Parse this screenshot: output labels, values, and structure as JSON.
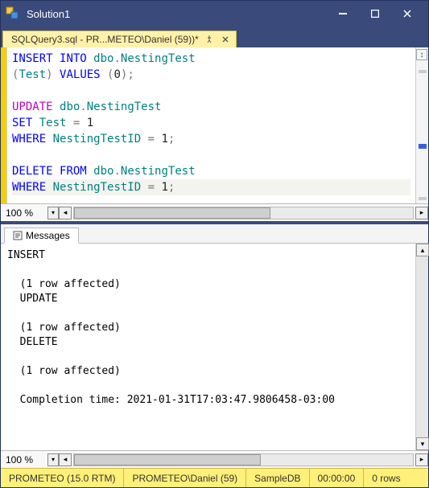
{
  "window": {
    "title": "Solution1"
  },
  "tab": {
    "label": "SQLQuery3.sql - PR...METEO\\Daniel (59))*"
  },
  "editor": {
    "zoom": "100 %",
    "code": {
      "l1_kw1": "INSERT",
      "l1_kw2": "INTO",
      "l1_obj": "dbo",
      "l1_dot": ".",
      "l1_tbl": "NestingTest",
      "l2_open": "(",
      "l2_col": "Test",
      "l2_close": ")",
      "l2_kw": "VALUES",
      "l2_open2": "(",
      "l2_val": "0",
      "l2_close2": ")",
      "l2_semi": ";",
      "l3": "",
      "l4_kw": "UPDATE",
      "l4_obj": "dbo",
      "l4_dot": ".",
      "l4_tbl": "NestingTest",
      "l5_kw": "SET",
      "l5_col": "Test",
      "l5_eq": " = ",
      "l5_val": "1",
      "l6_kw": "WHERE",
      "l6_col": "NestingTestID",
      "l6_eq": " = ",
      "l6_val": "1",
      "l6_semi": ";",
      "l7": "",
      "l8_kw1": "DELETE",
      "l8_kw2": "FROM",
      "l8_obj": "dbo",
      "l8_dot": ".",
      "l8_tbl": "NestingTest",
      "l9_kw": "WHERE",
      "l9_col": "NestingTestID",
      "l9_eq": " = ",
      "l9_val": "1",
      "l9_semi": ";"
    }
  },
  "results": {
    "tab_label": "Messages",
    "zoom": "100 %",
    "lines": {
      "l1": "INSERT",
      "l2": "",
      "l3": "(1 row affected)",
      "l4": "UPDATE",
      "l5": "",
      "l6": "(1 row affected)",
      "l7": "DELETE",
      "l8": "",
      "l9": "(1 row affected)",
      "l10": "",
      "l11": "Completion time: 2021-01-31T17:03:47.9806458-03:00"
    }
  },
  "status": {
    "server": "PROMETEO (15.0 RTM)",
    "user": "PROMETEO\\Daniel (59)",
    "db": "SampleDB",
    "time": "00:00:00",
    "rows": "0 rows"
  }
}
